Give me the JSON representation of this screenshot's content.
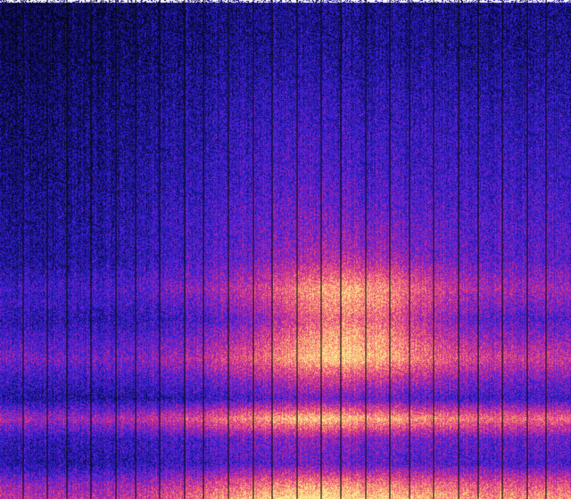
{
  "chart_data": {
    "type": "heatmap",
    "title": "",
    "xlabel": "",
    "ylabel": "",
    "x_origin": "left",
    "y_origin": "bottom",
    "colormap": [
      "#05051a",
      "#14117a",
      "#2a1fd0",
      "#6a22d6",
      "#b1259a",
      "#e2408a",
      "#f77a6e",
      "#f9c47a",
      "#fbf19e"
    ],
    "band_profile_top_to_bottom": [
      {
        "y": 0.0,
        "level": 0.16
      },
      {
        "y": 0.1,
        "level": 0.19
      },
      {
        "y": 0.22,
        "level": 0.27
      },
      {
        "y": 0.35,
        "level": 0.33
      },
      {
        "y": 0.45,
        "level": 0.4
      },
      {
        "y": 0.52,
        "level": 0.42
      },
      {
        "y": 0.58,
        "level": 0.6
      },
      {
        "y": 0.64,
        "level": 0.4
      },
      {
        "y": 0.72,
        "level": 0.72
      },
      {
        "y": 0.76,
        "level": 0.5
      },
      {
        "y": 0.8,
        "level": 0.34
      },
      {
        "y": 0.84,
        "level": 0.9
      },
      {
        "y": 0.88,
        "level": 0.45
      },
      {
        "y": 0.93,
        "level": 0.38
      },
      {
        "y": 0.97,
        "level": 0.8
      },
      {
        "y": 1.0,
        "level": 1.0
      }
    ],
    "time_envelope_left_to_right": [
      {
        "x": 0.0,
        "level": 0.55
      },
      {
        "x": 0.15,
        "level": 0.52
      },
      {
        "x": 0.25,
        "level": 0.58
      },
      {
        "x": 0.4,
        "level": 0.82
      },
      {
        "x": 0.55,
        "level": 1.0
      },
      {
        "x": 0.7,
        "level": 0.9
      },
      {
        "x": 0.85,
        "level": 0.8
      },
      {
        "x": 1.0,
        "level": 0.78
      }
    ],
    "hotspot": {
      "x": 0.62,
      "y": 0.64,
      "level": 1.0
    },
    "frame_lines": {
      "count": 24,
      "color": "#0a0a0a"
    },
    "top_edge_color": "#f3f0ff"
  }
}
